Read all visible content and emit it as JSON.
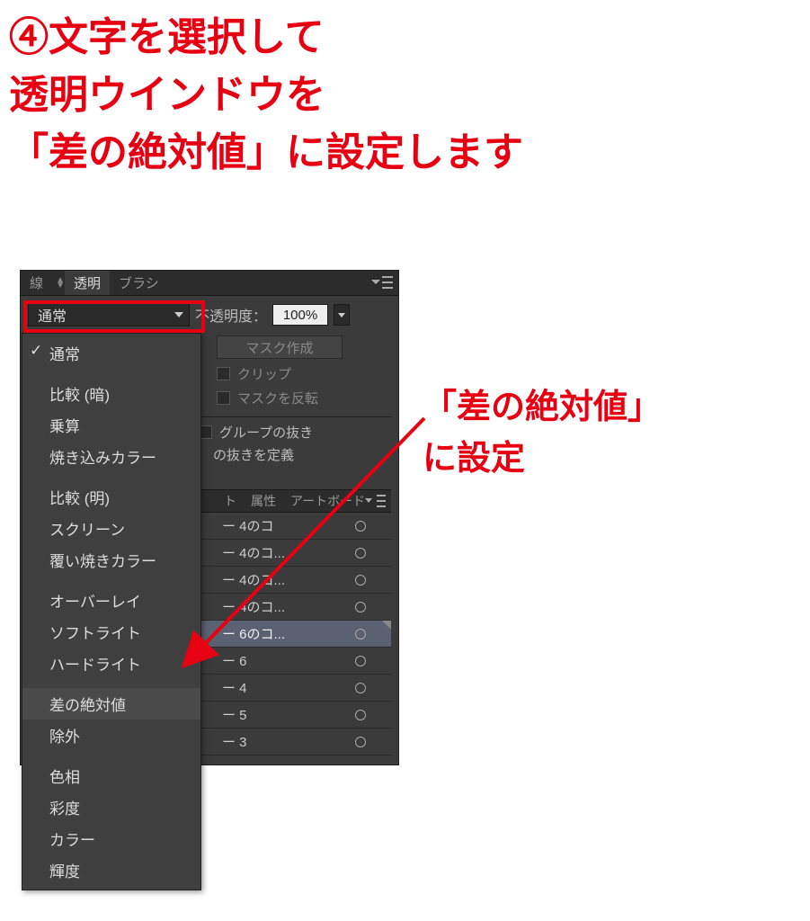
{
  "instruction": {
    "line1": "④文字を選択して",
    "line2": "透明ウインドウを",
    "line3": "「差の絶対値」に設定します"
  },
  "side_note": {
    "line1": "「差の絶対値」",
    "line2": "に設定"
  },
  "panel": {
    "tabs": {
      "stroke": "線",
      "transparency": "透明",
      "brush": "ブラシ"
    },
    "blend_selected": "通常",
    "opacity_label": "不透明度：",
    "opacity_value": "100%",
    "make_mask": "マスク作成",
    "clip": "クリップ",
    "invert_mask": "マスクを反転",
    "knockout_group": "グループの抜き",
    "define_knockout": "の抜きを定義"
  },
  "panel2": {
    "tabs": {
      "cut": "ト",
      "attributes": "属性",
      "artboard": "アートボード"
    }
  },
  "layer_list": [
    {
      "label": "ー 4のコ",
      "selected": false,
      "corner": false
    },
    {
      "label": "ー 4のコ...",
      "selected": false,
      "corner": false
    },
    {
      "label": "ー 4のコ...",
      "selected": false,
      "corner": false
    },
    {
      "label": "ー 4のコ...",
      "selected": false,
      "corner": false
    },
    {
      "label": "ー 6のコ...",
      "selected": true,
      "corner": true
    },
    {
      "label": "ー 6",
      "selected": false,
      "corner": false
    },
    {
      "label": "ー 4",
      "selected": false,
      "corner": false
    },
    {
      "label": "ー 5",
      "selected": false,
      "corner": false
    },
    {
      "label": "ー 3",
      "selected": false,
      "corner": false
    }
  ],
  "dropdown": {
    "items": [
      {
        "label": "通常",
        "checked": true
      },
      null,
      {
        "label": "比較 (暗)"
      },
      {
        "label": "乗算"
      },
      {
        "label": "焼き込みカラー"
      },
      null,
      {
        "label": "比較 (明)"
      },
      {
        "label": "スクリーン"
      },
      {
        "label": "覆い焼きカラー"
      },
      null,
      {
        "label": "オーバーレイ"
      },
      {
        "label": "ソフトライト"
      },
      {
        "label": "ハードライト"
      },
      null,
      {
        "label": "差の絶対値",
        "highlight": true
      },
      {
        "label": "除外"
      },
      null,
      {
        "label": "色相"
      },
      {
        "label": "彩度"
      },
      {
        "label": "カラー"
      },
      {
        "label": "輝度"
      }
    ]
  }
}
